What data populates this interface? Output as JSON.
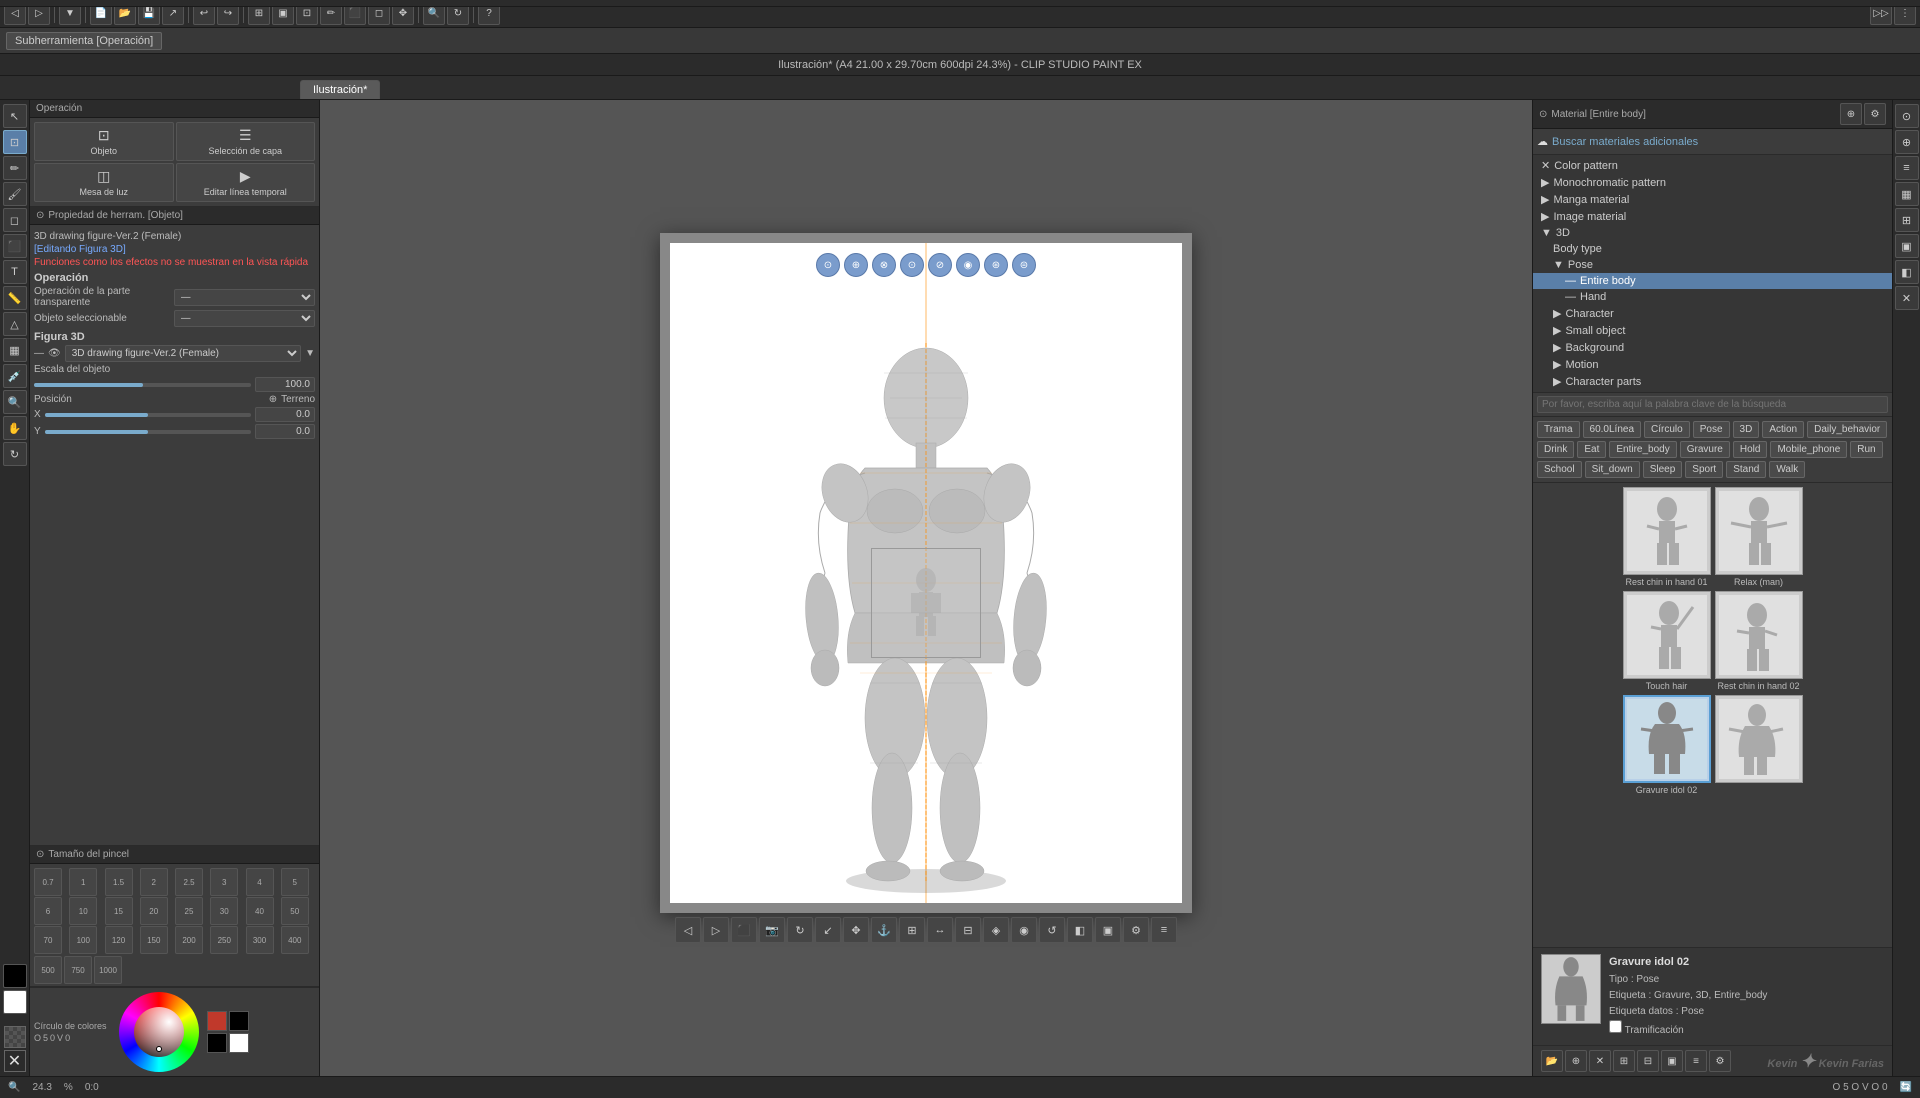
{
  "app": {
    "title": "Ilustración* (A4 21.00 x 29.70cm 600dpi 24.3%)  -  CLIP STUDIO PAINT EX",
    "tab": "Ilustración*"
  },
  "toolbar": {
    "subtool_label": "Subherramienta [Operación]"
  },
  "left_panel": {
    "operation_title": "Operación",
    "sub_tools": [
      {
        "label": "Objeto",
        "icon": "⊡"
      },
      {
        "label": "Selección de capa",
        "icon": "☰"
      },
      {
        "label": "Mesa de luz",
        "icon": "◫"
      },
      {
        "label": "Editar línea temporal",
        "icon": "▶"
      }
    ],
    "property_title": "Propiedad de herram. [Objeto]",
    "figure_info": "3D drawing figure-Ver.2 (Female)",
    "edit_label": "[Editando Figura 3D]",
    "warning": "Funciones como los efectos no se muestran en la vista rápida",
    "operation_label": "Operación",
    "transparent_label": "Operación de la parte transparente",
    "selectable_label": "Objeto seleccionable",
    "figura3d_label": "Figura 3D",
    "figure_select": "3D drawing figure-Ver.2 (Female)",
    "scale_label": "Escala del objeto",
    "scale_value": "100.0",
    "position_label": "Posición",
    "terrain_label": "Terreno",
    "x_label": "X",
    "y_label": "Y",
    "x_value": "0.0",
    "y_value": "0.0",
    "brush_title": "Tamaño del pincel",
    "brush_sizes": [
      "0.7",
      "1",
      "1.5",
      "2",
      "2.5",
      "3",
      "4",
      "5",
      "6",
      "10",
      "15",
      "20",
      "25",
      "30",
      "40",
      "50",
      "70",
      "100",
      "120",
      "150",
      "200",
      "250",
      "300",
      "400",
      "500",
      "750",
      "1000"
    ],
    "color_circle_label": "Círculo de colores"
  },
  "right_panel": {
    "header": "Material [Entire body]",
    "search_placeholder": "Buscar materiales adicionales",
    "search_keyword_placeholder": "Por favor, escriba aquí la palabra clave de la búsqueda",
    "tree": {
      "items": [
        {
          "label": "Color pattern",
          "level": 0,
          "icon": "✕"
        },
        {
          "label": "Monochromatic pattern",
          "level": 0
        },
        {
          "label": "Manga material",
          "level": 0
        },
        {
          "label": "Image material",
          "level": 0
        },
        {
          "label": "3D",
          "level": 0,
          "expanded": true
        },
        {
          "label": "Body type",
          "level": 1
        },
        {
          "label": "Pose",
          "level": 1,
          "expanded": true
        },
        {
          "label": "Entire body",
          "level": 2,
          "active": true
        },
        {
          "label": "Hand",
          "level": 2
        },
        {
          "label": "Character",
          "level": 1
        },
        {
          "label": "Small object",
          "level": 1
        },
        {
          "label": "Background",
          "level": 1
        },
        {
          "label": "Motion",
          "level": 1
        },
        {
          "label": "Character parts",
          "level": 1
        }
      ]
    },
    "tags": [
      "Trama",
      "60.0Línea",
      "Círculo",
      "Pose",
      "3D",
      "Action",
      "Daily_behavior",
      "Drink",
      "Eat",
      "Entire_body",
      "Gravure",
      "Hold",
      "Mobile_phone",
      "Run",
      "School",
      "Sit_down",
      "Sleep",
      "Sport",
      "Stand",
      "Walk"
    ],
    "thumbnails": [
      {
        "name": "Rest chin in hand 01",
        "selected": false
      },
      {
        "name": "Relax (man)",
        "selected": false
      },
      {
        "name": "Touch hair",
        "selected": false
      },
      {
        "name": "Rest chin in hand 02",
        "selected": false
      },
      {
        "name": "Gravure idol 02",
        "selected": true
      },
      {
        "name": "",
        "selected": false
      }
    ],
    "material_info": {
      "name": "Gravure idol 02",
      "type_label": "Tipo :",
      "type": "Pose",
      "tag_label": "Etiqueta :",
      "tags": "Gravure, 3D, Entire_body",
      "data_tag_label": "Etiqueta datos :",
      "data_tag": "Pose",
      "tramification_label": "Tramificación"
    },
    "watermark": "Kevin Farias"
  },
  "status_bar": {
    "zoom": "24.3",
    "coords": "0:0",
    "extra": ""
  },
  "canvas": {
    "top_icons": [
      "⊙",
      "⊕",
      "⊗",
      "⊘",
      "⊝",
      "◉",
      "⊛",
      "⊜"
    ],
    "figure_alt": "3D Female Figure"
  }
}
